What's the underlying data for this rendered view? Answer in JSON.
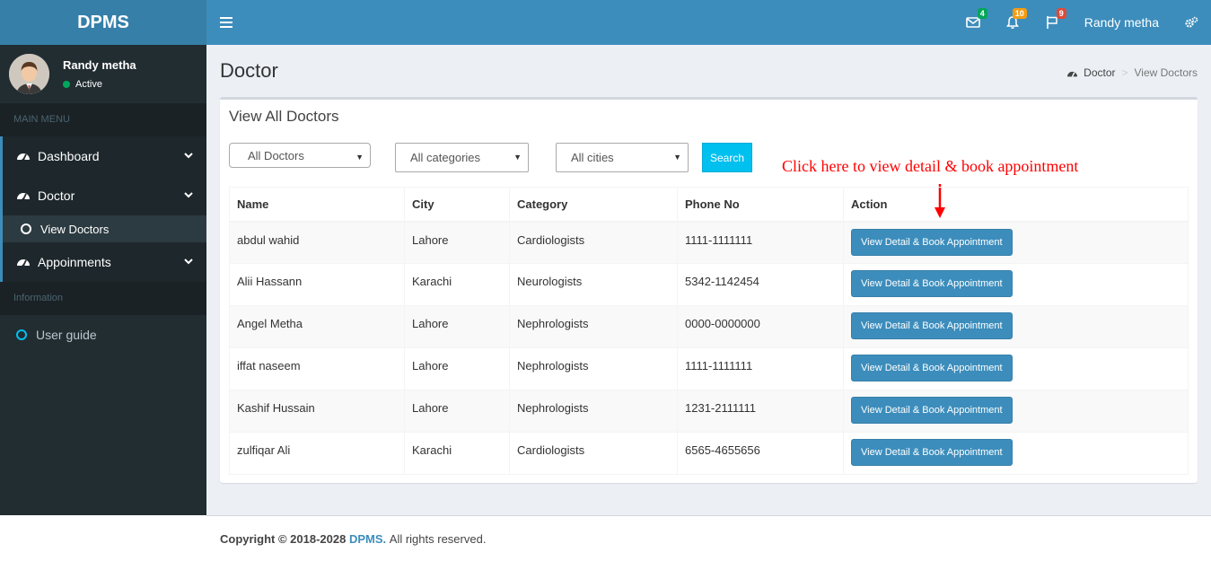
{
  "app": {
    "logo": "DPMS"
  },
  "header": {
    "user_name": "Randy metha",
    "badges": {
      "messages": "4",
      "notifications": "10",
      "tasks": "9"
    }
  },
  "sidebar": {
    "user": {
      "name": "Randy metha",
      "status": "Active"
    },
    "main_menu_header": "MAIN MENU",
    "items": [
      {
        "label": "Dashboard"
      },
      {
        "label": "Doctor"
      },
      {
        "label": "View Doctors"
      },
      {
        "label": "Appoinments"
      }
    ],
    "info_header": "Information",
    "user_guide": "User guide"
  },
  "page": {
    "title": "Doctor",
    "breadcrumb": {
      "home": "Doctor",
      "current": "View Doctors"
    }
  },
  "box": {
    "title": "View All Doctors",
    "filters": {
      "doctors": "All Doctors",
      "categories": "All categories",
      "cities": "All cities"
    },
    "search_label": "Search",
    "annotation": "Click here to view detail & book appointment"
  },
  "table": {
    "headers": [
      "Name",
      "City",
      "Category",
      "Phone No",
      "Action"
    ],
    "action_label": "View Detail & Book Appointment",
    "rows": [
      [
        "abdul wahid",
        "Lahore",
        "Cardiologists",
        "1111-1111111"
      ],
      [
        "Alii Hassann",
        "Karachi",
        "Neurologists",
        "5342-1142454"
      ],
      [
        "Angel Metha",
        "Lahore",
        "Nephrologists",
        "0000-0000000"
      ],
      [
        "iffat naseem",
        "Lahore",
        "Nephrologists",
        "1111-1111111"
      ],
      [
        "Kashif Hussain",
        "Lahore",
        "Nephrologists",
        "1231-2111111"
      ],
      [
        "zulfiqar Ali",
        "Karachi",
        "Cardiologists",
        "6565-4655656"
      ]
    ]
  },
  "footer": {
    "copyright": "Copyright © 2018-2028",
    "brand": "DPMS.",
    "rights": "All rights reserved."
  },
  "colors": {
    "primary": "#3c8dbc",
    "logo_bg": "#367fa9",
    "sidebar_bg": "#222d32",
    "search_button": "#00c0ef",
    "annotation": "#ff0000"
  }
}
